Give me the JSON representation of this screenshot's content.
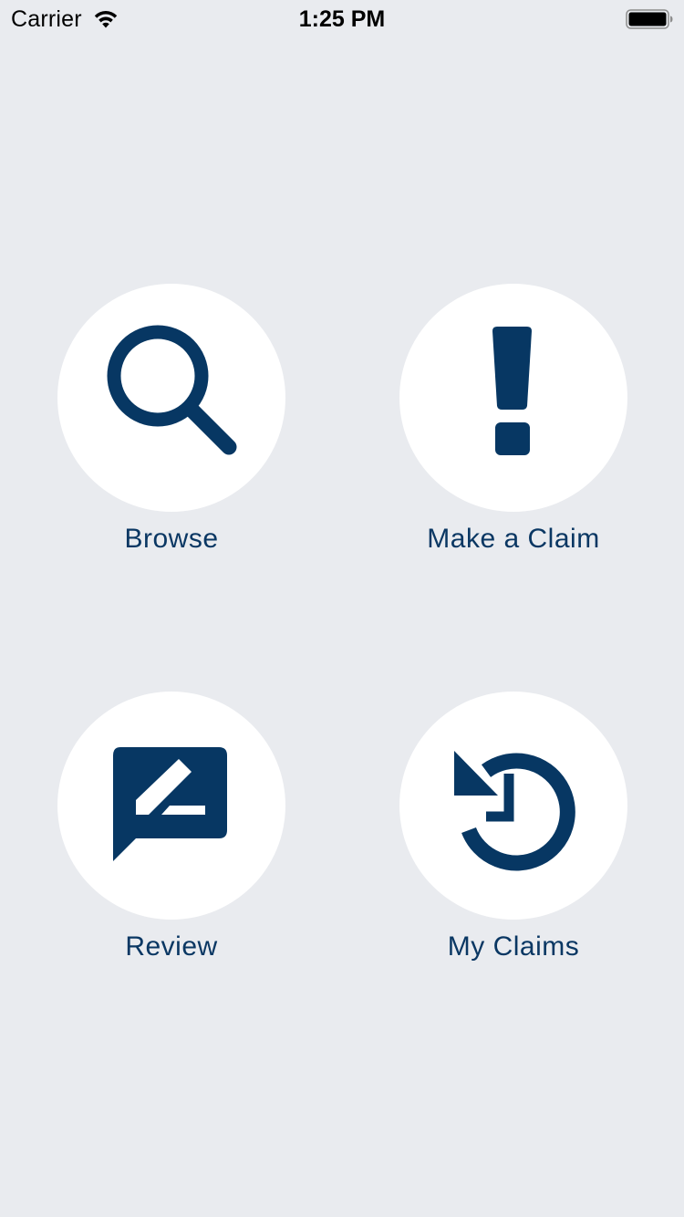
{
  "status_bar": {
    "carrier": "Carrier",
    "time": "1:25 PM"
  },
  "colors": {
    "background": "#e9ebef",
    "accent": "#073763",
    "circle": "#ffffff"
  },
  "menu": {
    "items": [
      {
        "label": "Browse",
        "icon": "search-icon"
      },
      {
        "label": "Make a Claim",
        "icon": "exclamation-icon"
      },
      {
        "label": "Review",
        "icon": "review-icon"
      },
      {
        "label": "My Claims",
        "icon": "history-icon"
      }
    ]
  }
}
